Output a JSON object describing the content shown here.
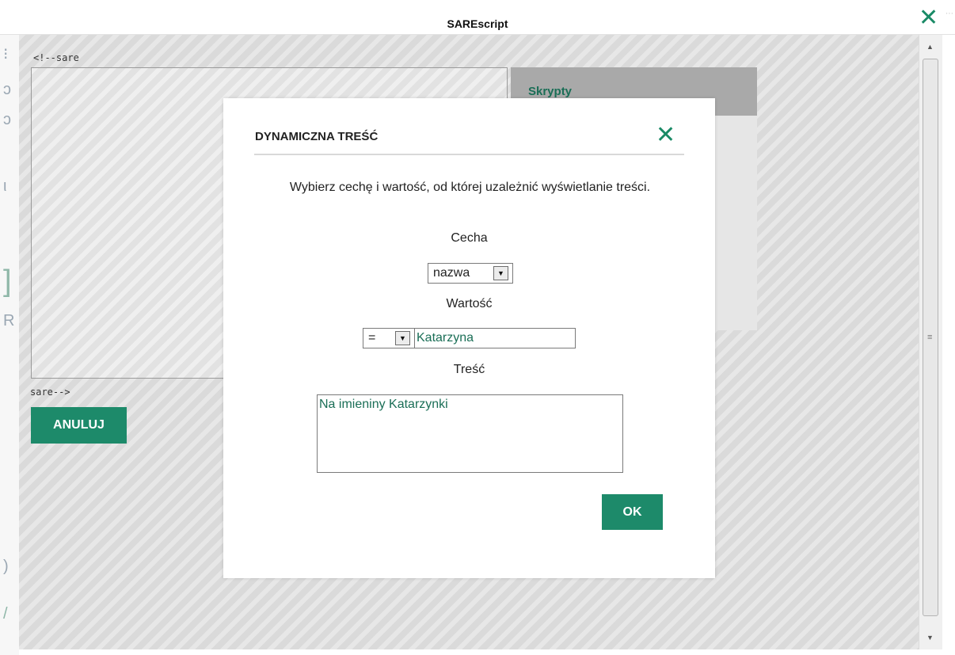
{
  "window": {
    "title": "SAREscript"
  },
  "background": {
    "left_strip_glyphs": [
      "⁝",
      "ↄ",
      "ↄ",
      "ι",
      "]",
      "R",
      ")",
      "/"
    ]
  },
  "editor": {
    "open_tag": "<!--sare",
    "close_tag": "sare-->"
  },
  "side_panel": {
    "header": "Skrypty"
  },
  "actions": {
    "cancel_label": "ANULUJ"
  },
  "icons": {
    "close": "close-icon",
    "dropdown": "chevron-down-icon"
  },
  "colors": {
    "accent": "#1d8a6a",
    "bound_text": "#1a6e56"
  },
  "dialog": {
    "title": "DYNAMICZNA TREŚĆ",
    "description": "Wybierz cechę i wartość, od której uzależnić wyświetlanie treści.",
    "feature_label": "Cecha",
    "feature_value": "nazwa",
    "value_label": "Wartość",
    "operator_value": "=",
    "value_input": "Katarzyna",
    "content_label": "Treść",
    "content_value": "Na imieniny Katarzynki",
    "ok_label": "OK"
  }
}
